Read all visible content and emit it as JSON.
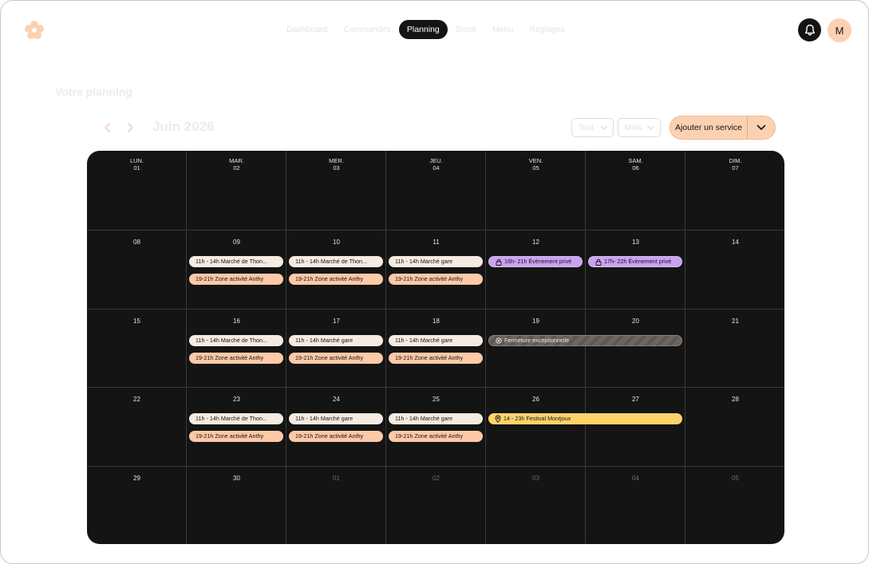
{
  "nav": {
    "items": [
      {
        "label": "Dashboard"
      },
      {
        "label": "Commandes"
      },
      {
        "label": "Planning"
      },
      {
        "label": "Stock"
      },
      {
        "label": "Menu"
      },
      {
        "label": "Réglages"
      }
    ],
    "active": "Planning"
  },
  "user": {
    "avatar_initial": "M"
  },
  "page": {
    "title": "Votre planning"
  },
  "toolbar": {
    "month": "Juin 2026",
    "filter_select": "Tout",
    "view_select": "Mois",
    "add_button": "Ajouter un service"
  },
  "calendar": {
    "weekdays": [
      {
        "name": "LUN.",
        "date": "01"
      },
      {
        "name": "MAR.",
        "date": "02"
      },
      {
        "name": "MER.",
        "date": "03"
      },
      {
        "name": "JEU.",
        "date": "04"
      },
      {
        "name": "VEN.",
        "date": "05"
      },
      {
        "name": "SAM.",
        "date": "06"
      },
      {
        "name": "DIM.",
        "date": "07"
      }
    ],
    "weeks": [
      [
        {
          "day": "08",
          "muted": false
        },
        {
          "day": "09",
          "muted": false
        },
        {
          "day": "10",
          "muted": false
        },
        {
          "day": "11",
          "muted": false
        },
        {
          "day": "12",
          "muted": false
        },
        {
          "day": "13",
          "muted": false
        },
        {
          "day": "14",
          "muted": false
        }
      ],
      [
        {
          "day": "15",
          "muted": false
        },
        {
          "day": "16",
          "muted": false
        },
        {
          "day": "17",
          "muted": false
        },
        {
          "day": "18",
          "muted": false
        },
        {
          "day": "19",
          "muted": false
        },
        {
          "day": "20",
          "muted": false
        },
        {
          "day": "21",
          "muted": false
        }
      ],
      [
        {
          "day": "22",
          "muted": false
        },
        {
          "day": "23",
          "muted": false
        },
        {
          "day": "24",
          "muted": false
        },
        {
          "day": "25",
          "muted": false
        },
        {
          "day": "26",
          "muted": false
        },
        {
          "day": "27",
          "muted": false
        },
        {
          "day": "28",
          "muted": false
        }
      ],
      [
        {
          "day": "29",
          "muted": false
        },
        {
          "day": "30",
          "muted": false
        },
        {
          "day": "01",
          "muted": true
        },
        {
          "day": "02",
          "muted": true
        },
        {
          "day": "03",
          "muted": true
        },
        {
          "day": "04",
          "muted": true
        },
        {
          "day": "05",
          "muted": true
        }
      ]
    ],
    "events": [
      {
        "week": 1,
        "day": 1,
        "slot": 0,
        "span": 1,
        "kind": "cream",
        "label": "11h - 14h Marché de Thon..."
      },
      {
        "week": 1,
        "day": 1,
        "slot": 1,
        "span": 1,
        "kind": "peach",
        "label": "19-21h Zone activité Anthy"
      },
      {
        "week": 1,
        "day": 2,
        "slot": 0,
        "span": 1,
        "kind": "cream",
        "label": "11h - 14h Marché de Thon..."
      },
      {
        "week": 1,
        "day": 2,
        "slot": 1,
        "span": 1,
        "kind": "peach",
        "label": "19-21h Zone activité Anthy"
      },
      {
        "week": 1,
        "day": 3,
        "slot": 0,
        "span": 1,
        "kind": "cream",
        "label": "11h - 14h Marché gare"
      },
      {
        "week": 1,
        "day": 3,
        "slot": 1,
        "span": 1,
        "kind": "peach",
        "label": "19-21h Zone activité Anthy"
      },
      {
        "week": 1,
        "day": 4,
        "slot": 0,
        "span": 1,
        "kind": "purple",
        "icon": "lock-icon",
        "label": "16h- 21h Évènement privé"
      },
      {
        "week": 1,
        "day": 5,
        "slot": 0,
        "span": 1,
        "kind": "purple",
        "icon": "lock-icon",
        "label": "17h- 22h Évènement privé"
      },
      {
        "week": 2,
        "day": 1,
        "slot": 0,
        "span": 1,
        "kind": "cream",
        "label": "11h - 14h Marché de Thon..."
      },
      {
        "week": 2,
        "day": 1,
        "slot": 1,
        "span": 1,
        "kind": "peach",
        "label": "19-21h Zone activité Anthy"
      },
      {
        "week": 2,
        "day": 2,
        "slot": 0,
        "span": 1,
        "kind": "cream",
        "label": "11h - 14h Marché gare"
      },
      {
        "week": 2,
        "day": 2,
        "slot": 1,
        "span": 1,
        "kind": "peach",
        "label": "19-21h Zone activité Anthy"
      },
      {
        "week": 2,
        "day": 3,
        "slot": 0,
        "span": 1,
        "kind": "cream",
        "label": "11h - 14h Marché gare"
      },
      {
        "week": 2,
        "day": 3,
        "slot": 1,
        "span": 1,
        "kind": "peach",
        "label": "19-21h Zone activité Anthy"
      },
      {
        "week": 2,
        "day": 4,
        "slot": 0,
        "span": 2,
        "kind": "grey",
        "icon": "closed-icon",
        "label": "Fermeture exceptionnelle"
      },
      {
        "week": 3,
        "day": 1,
        "slot": 0,
        "span": 1,
        "kind": "cream",
        "label": "11h - 14h Marché de Thon..."
      },
      {
        "week": 3,
        "day": 1,
        "slot": 1,
        "span": 1,
        "kind": "peach",
        "label": "19-21h Zone activité Anthy"
      },
      {
        "week": 3,
        "day": 2,
        "slot": 0,
        "span": 1,
        "kind": "cream",
        "label": "11h - 14h Marché gare"
      },
      {
        "week": 3,
        "day": 2,
        "slot": 1,
        "span": 1,
        "kind": "peach",
        "label": "19-21h Zone activité Anthy"
      },
      {
        "week": 3,
        "day": 3,
        "slot": 0,
        "span": 1,
        "kind": "cream",
        "label": "11h - 14h Marché gare"
      },
      {
        "week": 3,
        "day": 3,
        "slot": 1,
        "span": 1,
        "kind": "peach",
        "label": "19-21h Zone activité Anthy"
      },
      {
        "week": 3,
        "day": 4,
        "slot": 0,
        "span": 2,
        "kind": "yellow",
        "icon": "location-pin-icon",
        "label": "14 - 23h Festival Montjoux"
      }
    ]
  }
}
